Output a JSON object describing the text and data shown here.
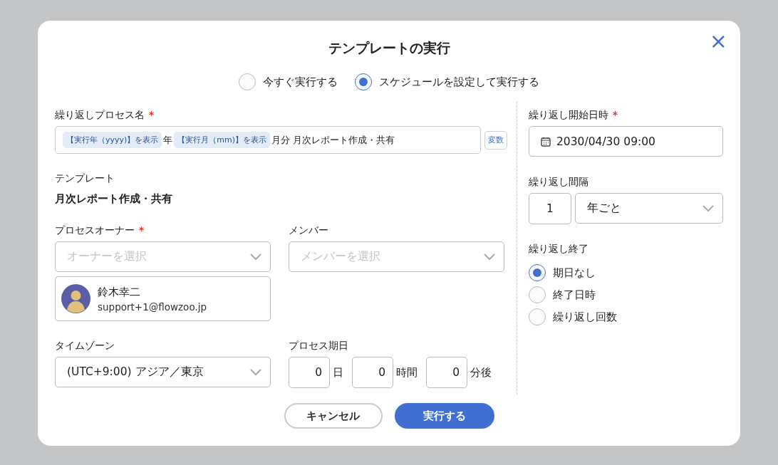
{
  "dialog": {
    "title": "テンプレートの実行",
    "close_icon": "×"
  },
  "run_modes": [
    {
      "label": "今すぐ実行する",
      "selected": false
    },
    {
      "label": "スケジュールを設定して実行する",
      "selected": true
    }
  ],
  "process_name": {
    "label": "繰り返しプロセス名",
    "required_mark": "*",
    "segments": [
      {
        "kind": "token",
        "text": "【実行年（yyyy)】を表示"
      },
      {
        "kind": "text",
        "text": "年"
      },
      {
        "kind": "token",
        "text": "【実行月（mm)】を表示"
      },
      {
        "kind": "text",
        "text": "月分 月次レポート作成・共有"
      }
    ],
    "variable_button": "変数"
  },
  "template": {
    "label": "テンプレート",
    "value": "月次レポート作成・共有"
  },
  "owner": {
    "label": "プロセスオーナー",
    "required_mark": "*",
    "placeholder": "オーナーを選択",
    "selected_user": {
      "name": "鈴木幸二",
      "email": "support+1@flowzoo.jp"
    }
  },
  "members": {
    "label": "メンバー",
    "placeholder": "メンバーを選択"
  },
  "timezone": {
    "label": "タイムゾーン",
    "value": "(UTC+9:00) アジア／東京"
  },
  "due": {
    "label": "プロセス期日",
    "parts": [
      {
        "value": "0",
        "unit": "日"
      },
      {
        "value": "0",
        "unit": "時間"
      },
      {
        "value": "0",
        "unit": "分後"
      }
    ]
  },
  "start": {
    "label": "繰り返し開始日時",
    "required_mark": "*",
    "value": "2030/04/30 09:00"
  },
  "interval": {
    "label": "繰り返し間隔",
    "count": "1",
    "unit": "年ごと"
  },
  "end": {
    "label": "繰り返し終了",
    "options": [
      {
        "label": "期日なし",
        "selected": true
      },
      {
        "label": "終了日時",
        "selected": false
      },
      {
        "label": "繰り返し回数",
        "selected": false
      }
    ]
  },
  "buttons": [
    {
      "kind": "secondary",
      "label": "キャンセル"
    },
    {
      "kind": "primary",
      "label": "実行する"
    }
  ]
}
